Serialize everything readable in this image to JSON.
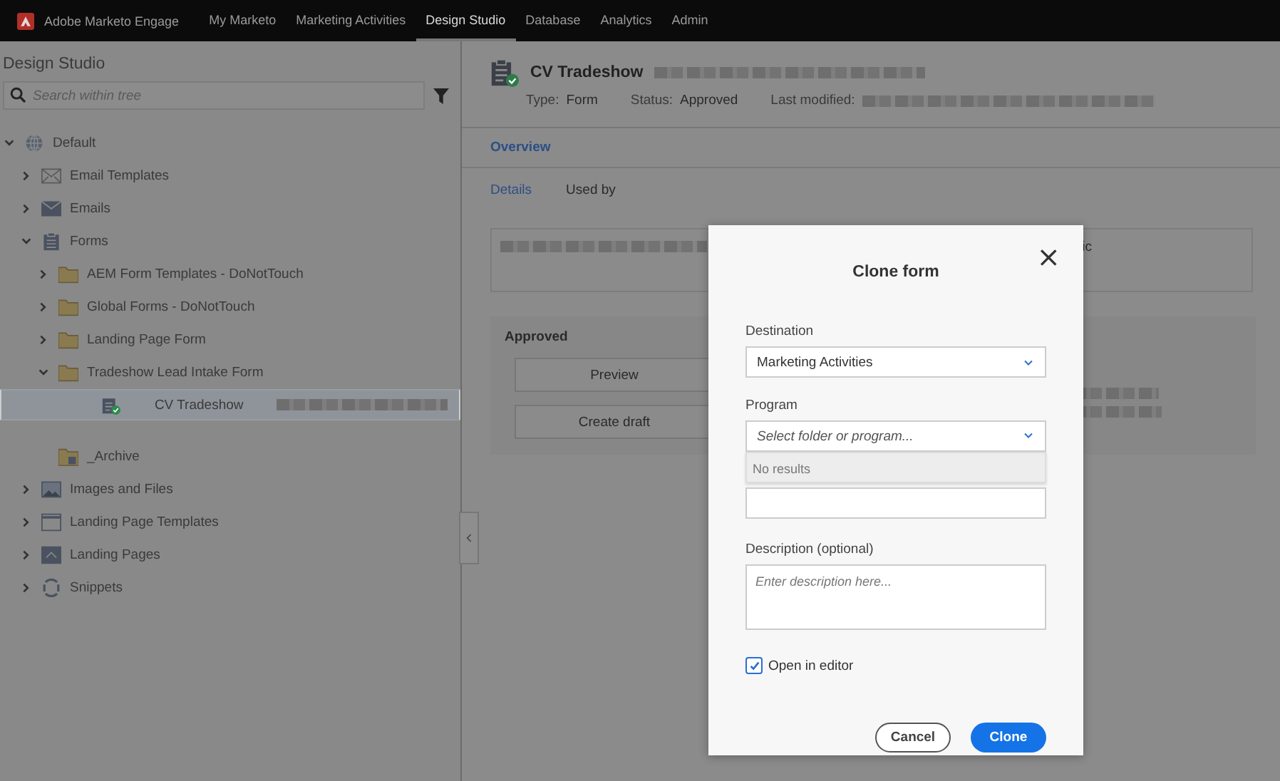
{
  "top_nav": {
    "brand": "Adobe Marketo Engage",
    "items": [
      {
        "label": "My Marketo",
        "selected": false
      },
      {
        "label": "Marketing Activities",
        "selected": false
      },
      {
        "label": "Design Studio",
        "selected": true
      },
      {
        "label": "Database",
        "selected": false
      },
      {
        "label": "Analytics",
        "selected": false
      },
      {
        "label": "Admin",
        "selected": false
      }
    ]
  },
  "sidebar": {
    "title": "Design Studio",
    "search": {
      "placeholder": "Search within tree"
    },
    "tree": [
      {
        "label": "Default",
        "kind": "globe",
        "expanded": true,
        "selected": false,
        "children": [
          {
            "label": "Email Templates",
            "kind": "email-template",
            "expanded": false,
            "selected": false
          },
          {
            "label": "Emails",
            "kind": "email",
            "expanded": false,
            "selected": false
          },
          {
            "label": "Forms",
            "kind": "forms",
            "expanded": true,
            "selected": false,
            "children": [
              {
                "label": "AEM Form Templates - DoNotTouch",
                "kind": "folder",
                "expanded": false,
                "selected": false
              },
              {
                "label": "Global Forms - DoNotTouch",
                "kind": "folder",
                "expanded": false,
                "selected": false
              },
              {
                "label": "Landing Page Form",
                "kind": "folder",
                "expanded": false,
                "selected": false
              },
              {
                "label": "Tradeshow Lead Intake Form",
                "kind": "folder",
                "expanded": true,
                "selected": false,
                "children": [
                  {
                    "label": "CV Tradeshow",
                    "kind": "form",
                    "selected": true
                  }
                ]
              },
              {
                "label": "_Archive",
                "kind": "archive",
                "selected": false
              }
            ]
          },
          {
            "label": "Images and Files",
            "kind": "image",
            "expanded": false,
            "selected": false
          },
          {
            "label": "Landing Page Templates",
            "kind": "page-template",
            "expanded": false,
            "selected": false
          },
          {
            "label": "Landing Pages",
            "kind": "landing-page",
            "expanded": false,
            "selected": false
          },
          {
            "label": "Snippets",
            "kind": "snippet",
            "expanded": false,
            "selected": false
          }
        ]
      }
    ]
  },
  "asset": {
    "title": "CV Tradeshow",
    "type_label": "Type:",
    "type": "Form",
    "status_label": "Status:",
    "status": "Approved",
    "modified_label": "Last modified:"
  },
  "tabs": [
    {
      "label": "Overview",
      "selected": true
    }
  ],
  "sub_tabs": [
    {
      "label": "Details",
      "selected": true
    },
    {
      "label": "Used by",
      "selected": false
    }
  ],
  "details_card": {
    "fragment": "ic"
  },
  "approved_panel": {
    "title": "Approved",
    "buttons": [
      "Preview",
      "Create draft"
    ]
  },
  "dialog": {
    "title": "Clone form",
    "close": "×",
    "destination": {
      "label": "Destination",
      "value": "Marketing Activities"
    },
    "program": {
      "label": "Program",
      "placeholder": "Select folder or program...",
      "dropdown_message": "No results"
    },
    "description": {
      "label": "Description (optional)",
      "placeholder": "Enter description here..."
    },
    "open_in_editor": {
      "label": "Open in editor",
      "checked": true
    },
    "buttons": [
      {
        "label": "Cancel",
        "kind": "secondary"
      },
      {
        "label": "Clone",
        "kind": "primary"
      }
    ]
  }
}
